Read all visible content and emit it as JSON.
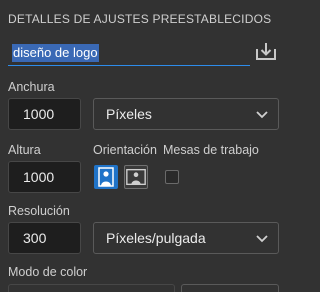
{
  "panel": {
    "title": "DETALLES DE AJUSTES PREESTABLECIDOS"
  },
  "preset_name": {
    "value": "diseño de logo"
  },
  "width": {
    "label": "Anchura",
    "value": "1000",
    "unit": "Píxeles"
  },
  "height": {
    "label": "Altura",
    "value": "1000"
  },
  "orientation": {
    "label": "Orientación",
    "selected": "portrait"
  },
  "artboards": {
    "label": "Mesas de trabajo",
    "checked": false
  },
  "resolution": {
    "label": "Resolución",
    "value": "300",
    "unit": "Píxeles/pulgada"
  },
  "color_mode": {
    "label": "Modo de color"
  },
  "colors": {
    "accent": "#2d8ceb",
    "selected_orientation": "#1f73c8",
    "background": "#323232"
  },
  "icons": {
    "save_preset": "save-preset-icon",
    "dropdown": "chevron-down-icon"
  }
}
